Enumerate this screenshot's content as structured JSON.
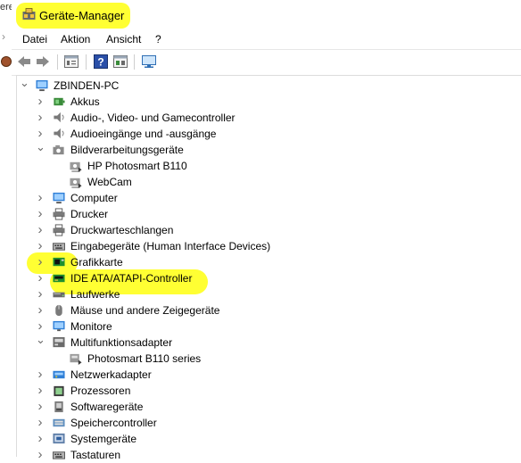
{
  "window": {
    "clipped_left_text": "ere",
    "title": "Geräte-Manager"
  },
  "menu": [
    "Datei",
    "Aktion",
    "Ansicht",
    "?"
  ],
  "toolbar": {
    "buttons": [
      "back-icon",
      "forward-icon",
      "properties-icon",
      "help-icon",
      "view-icon",
      "monitor-scan-icon"
    ]
  },
  "tree": {
    "root": "ZBINDEN-PC",
    "items": [
      {
        "label": "Akkus",
        "icon": "battery-icon",
        "expanded": false,
        "level": 1
      },
      {
        "label": "Audio-, Video- und Gamecontroller",
        "icon": "speaker-icon",
        "expanded": false,
        "level": 1
      },
      {
        "label": "Audioeingänge und -ausgänge",
        "icon": "speaker-icon",
        "expanded": false,
        "level": 1
      },
      {
        "label": "Bildverarbeitungsgeräte",
        "icon": "camera-icon",
        "expanded": true,
        "level": 1
      },
      {
        "label": "HP Photosmart B110",
        "icon": "camera-device-icon",
        "level": 2
      },
      {
        "label": "WebCam",
        "icon": "camera-device-icon",
        "level": 2
      },
      {
        "label": "Computer",
        "icon": "computer-icon",
        "expanded": false,
        "level": 1
      },
      {
        "label": "Drucker",
        "icon": "printer-icon",
        "expanded": false,
        "level": 1
      },
      {
        "label": "Druckwarteschlangen",
        "icon": "printer-icon",
        "expanded": false,
        "level": 1
      },
      {
        "label": "Eingabegeräte (Human Interface Devices)",
        "icon": "keyboard-icon",
        "expanded": false,
        "level": 1
      },
      {
        "label": "Grafikkarte",
        "icon": "display-adapter-icon",
        "expanded": false,
        "level": 1
      },
      {
        "label": "IDE ATA/ATAPI-Controller",
        "icon": "ide-controller-icon",
        "expanded": false,
        "level": 1
      },
      {
        "label": "Laufwerke",
        "icon": "disk-drive-icon",
        "expanded": false,
        "level": 1
      },
      {
        "label": "Mäuse und andere Zeigegeräte",
        "icon": "mouse-icon",
        "expanded": false,
        "level": 1
      },
      {
        "label": "Monitore",
        "icon": "monitor-icon",
        "expanded": false,
        "level": 1
      },
      {
        "label": "Multifunktionsadapter",
        "icon": "multifunction-icon",
        "expanded": true,
        "level": 1
      },
      {
        "label": "Photosmart B110 series",
        "icon": "multifunction-device-icon",
        "level": 2
      },
      {
        "label": "Netzwerkadapter",
        "icon": "network-adapter-icon",
        "expanded": false,
        "level": 1
      },
      {
        "label": "Prozessoren",
        "icon": "processor-icon",
        "expanded": false,
        "level": 1
      },
      {
        "label": "Softwaregeräte",
        "icon": "software-device-icon",
        "expanded": false,
        "level": 1
      },
      {
        "label": "Speichercontroller",
        "icon": "storage-controller-icon",
        "expanded": false,
        "level": 1
      },
      {
        "label": "Systemgeräte",
        "icon": "system-device-icon",
        "expanded": false,
        "level": 1
      },
      {
        "label": "Tastaturen",
        "icon": "keyboard-icon",
        "expanded": false,
        "level": 1
      }
    ]
  },
  "colors": {
    "highlight": "#ffff33",
    "accent": "#0078d7"
  }
}
